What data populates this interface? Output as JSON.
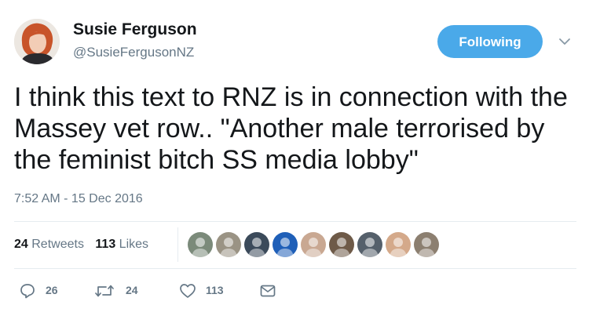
{
  "author": {
    "name": "Susie Ferguson",
    "handle": "@SusieFergusonNZ"
  },
  "follow_button": {
    "label": "Following"
  },
  "tweet": {
    "text": "I think this text to RNZ is in connection with the Massey vet row.. \"Another male terrorised by the feminist bitch SS media lobby\"",
    "timestamp": "7:52 AM - 15 Dec 2016"
  },
  "stats": {
    "retweets_count": "24",
    "retweets_label": "Retweets",
    "likes_count": "113",
    "likes_label": "Likes"
  },
  "likers": [
    {
      "icon": "liker-avatar-icon",
      "color": "#7b8a7a"
    },
    {
      "icon": "liker-avatar-icon",
      "color": "#9a9384"
    },
    {
      "icon": "liker-avatar-icon",
      "color": "#3b4a5a"
    },
    {
      "icon": "liker-avatar-icon",
      "color": "#1f5fb8"
    },
    {
      "icon": "liker-avatar-icon",
      "color": "#c9a892"
    },
    {
      "icon": "liker-avatar-icon",
      "color": "#6e5a48"
    },
    {
      "icon": "liker-avatar-icon",
      "color": "#55606b"
    },
    {
      "icon": "liker-avatar-icon",
      "color": "#d4a98a"
    },
    {
      "icon": "liker-avatar-icon",
      "color": "#8c7f70"
    }
  ],
  "actions": {
    "reply_count": "26",
    "retweet_count": "24",
    "like_count": "113"
  },
  "colors": {
    "accent": "#4aa9e9",
    "muted": "#657786",
    "text": "#14171a",
    "divider": "#e6ecf0"
  }
}
